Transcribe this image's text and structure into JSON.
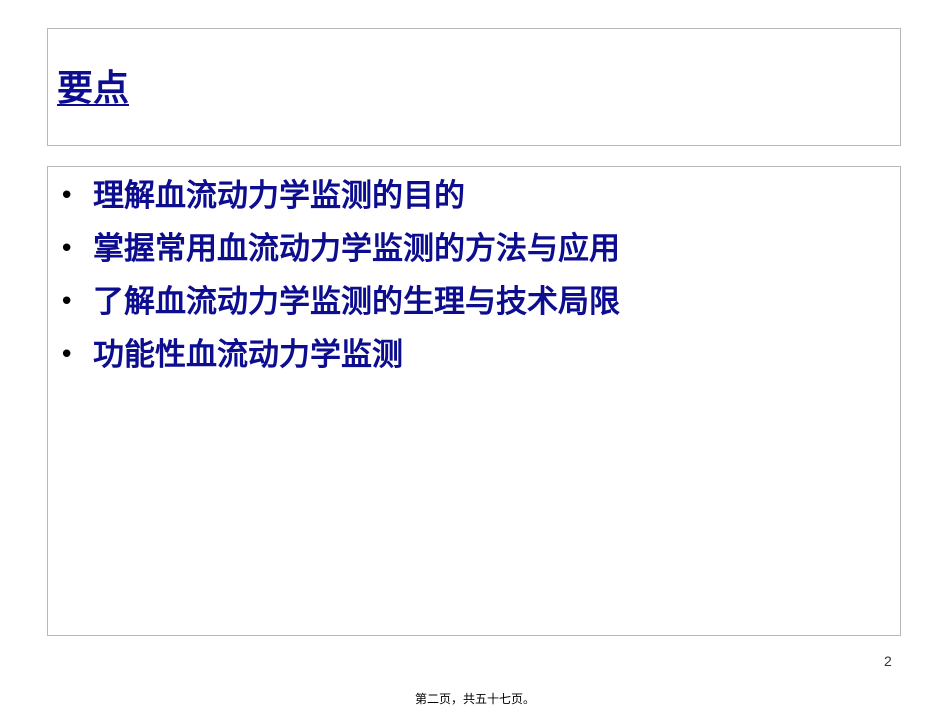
{
  "slide": {
    "title": "要点",
    "bullets": [
      {
        "symbol": "•",
        "text": "理解血流动力学监测的目的"
      },
      {
        "symbol": "•",
        "text": "掌握常用血流动力学监测的方法与应用"
      },
      {
        "symbol": "•",
        "text": "了解血流动力学监测的生理与技术局限"
      },
      {
        "symbol": "•",
        "text": "功能性血流动力学监测"
      }
    ],
    "page_number": "2",
    "footer": "第二页，共五十七页。"
  },
  "colors": {
    "text_blue": "#0d0d8f",
    "border": "#b8b8b8",
    "background": "#ffffff"
  }
}
